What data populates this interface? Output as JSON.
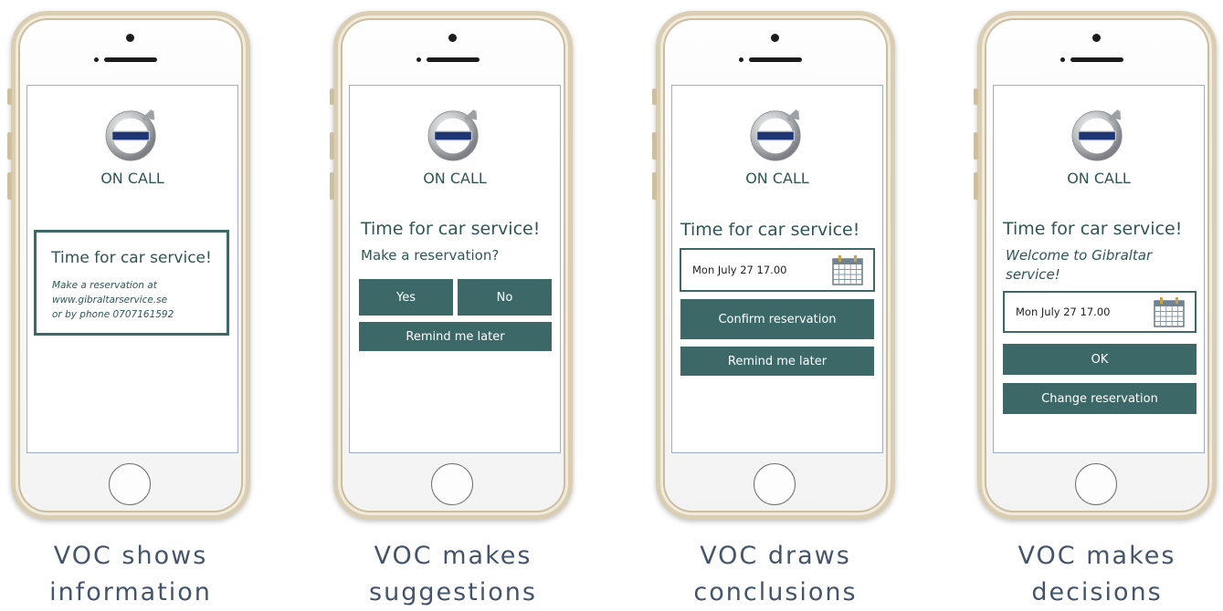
{
  "brand": {
    "logo_text": "VOLVO",
    "app_name": "ON CALL"
  },
  "colors": {
    "accent": "#3d6868",
    "text": "#2e5656",
    "caption": "#44546a",
    "frame": "#d9cdb3"
  },
  "phones": [
    {
      "message_title": "Time for car service!",
      "message_lines": [
        "Make a reservation at",
        "www.gibraltarservice.se",
        "or by phone 0707161592"
      ],
      "caption_lines": [
        "VOC shows",
        "information"
      ]
    },
    {
      "message_title": "Time for car service!",
      "question": "Make a reservation?",
      "yes_label": "Yes",
      "no_label": "No",
      "remind_label": "Remind me later",
      "caption_lines": [
        "VOC makes",
        "suggestions"
      ]
    },
    {
      "message_title": "Time for car service!",
      "date_value": "Mon July 27 17.00",
      "confirm_label": "Confirm reservation",
      "remind_label": "Remind me later",
      "caption_lines": [
        "VOC draws",
        "conclusions"
      ]
    },
    {
      "message_title": "Time for car service!",
      "welcome_lines": [
        "Welcome to Gibraltar",
        "service!"
      ],
      "date_value": "Mon July 27 17.00",
      "ok_label": "OK",
      "change_label": "Change reservation",
      "caption_lines": [
        "VOC makes",
        "decisions"
      ]
    }
  ]
}
